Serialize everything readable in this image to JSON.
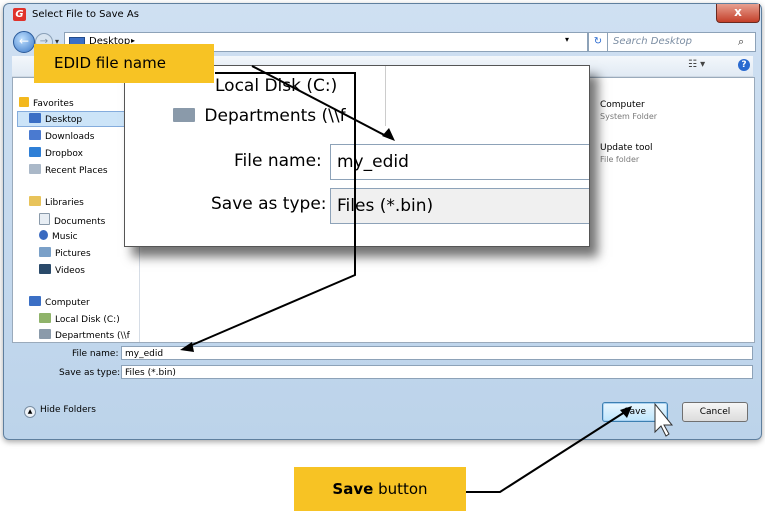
{
  "window": {
    "title": "Select File to Save As",
    "app_icon_glyph": "G",
    "close_glyph": "x"
  },
  "navbar": {
    "back_glyph": "←",
    "forward_glyph": "→",
    "address": "Desktop",
    "address_arrow": "▸",
    "refresh_glyph": "↻",
    "search_placeholder": "Search Desktop",
    "search_glyph": "⌕",
    "dropdown_glyph": "▾"
  },
  "toolbar": {
    "view_glyph": "☷ ▾",
    "help_glyph": "?"
  },
  "sidebar": {
    "favorites_label": "Favorites",
    "favorites": [
      "Desktop",
      "Downloads",
      "Dropbox",
      "Recent Places"
    ],
    "libraries_label": "Libraries",
    "libraries": [
      "Documents",
      "Music",
      "Pictures",
      "Videos"
    ],
    "computer_label": "Computer",
    "drives": [
      "Local Disk (C:)",
      "Departments (\\\\f"
    ]
  },
  "content": {
    "items": [
      {
        "title": "Computer",
        "subtitle": "System Folder"
      },
      {
        "title": "Update tool",
        "subtitle": "File folder"
      }
    ]
  },
  "fields": {
    "file_name_label": "File name:",
    "file_name_value": "my_edid",
    "save_type_label": "Save as type:",
    "save_type_value": "Files (*.bin)"
  },
  "footer": {
    "hide_folders": "Hide Folders",
    "save": "Save",
    "cancel": "Cancel"
  },
  "zoom": {
    "local_disk": "Local Disk (C:)",
    "departments": "Departments (\\\\f",
    "file_name_label": "File name:",
    "file_name_value": "my_edid",
    "save_type_label": "Save as type:",
    "save_type_value": "Files (*.bin)"
  },
  "callouts": {
    "edid": "EDID file name",
    "save_bold": "Save",
    "save_rest": " button"
  },
  "colors": {
    "callout": "#f7c324",
    "selection": "#cce4f8"
  }
}
